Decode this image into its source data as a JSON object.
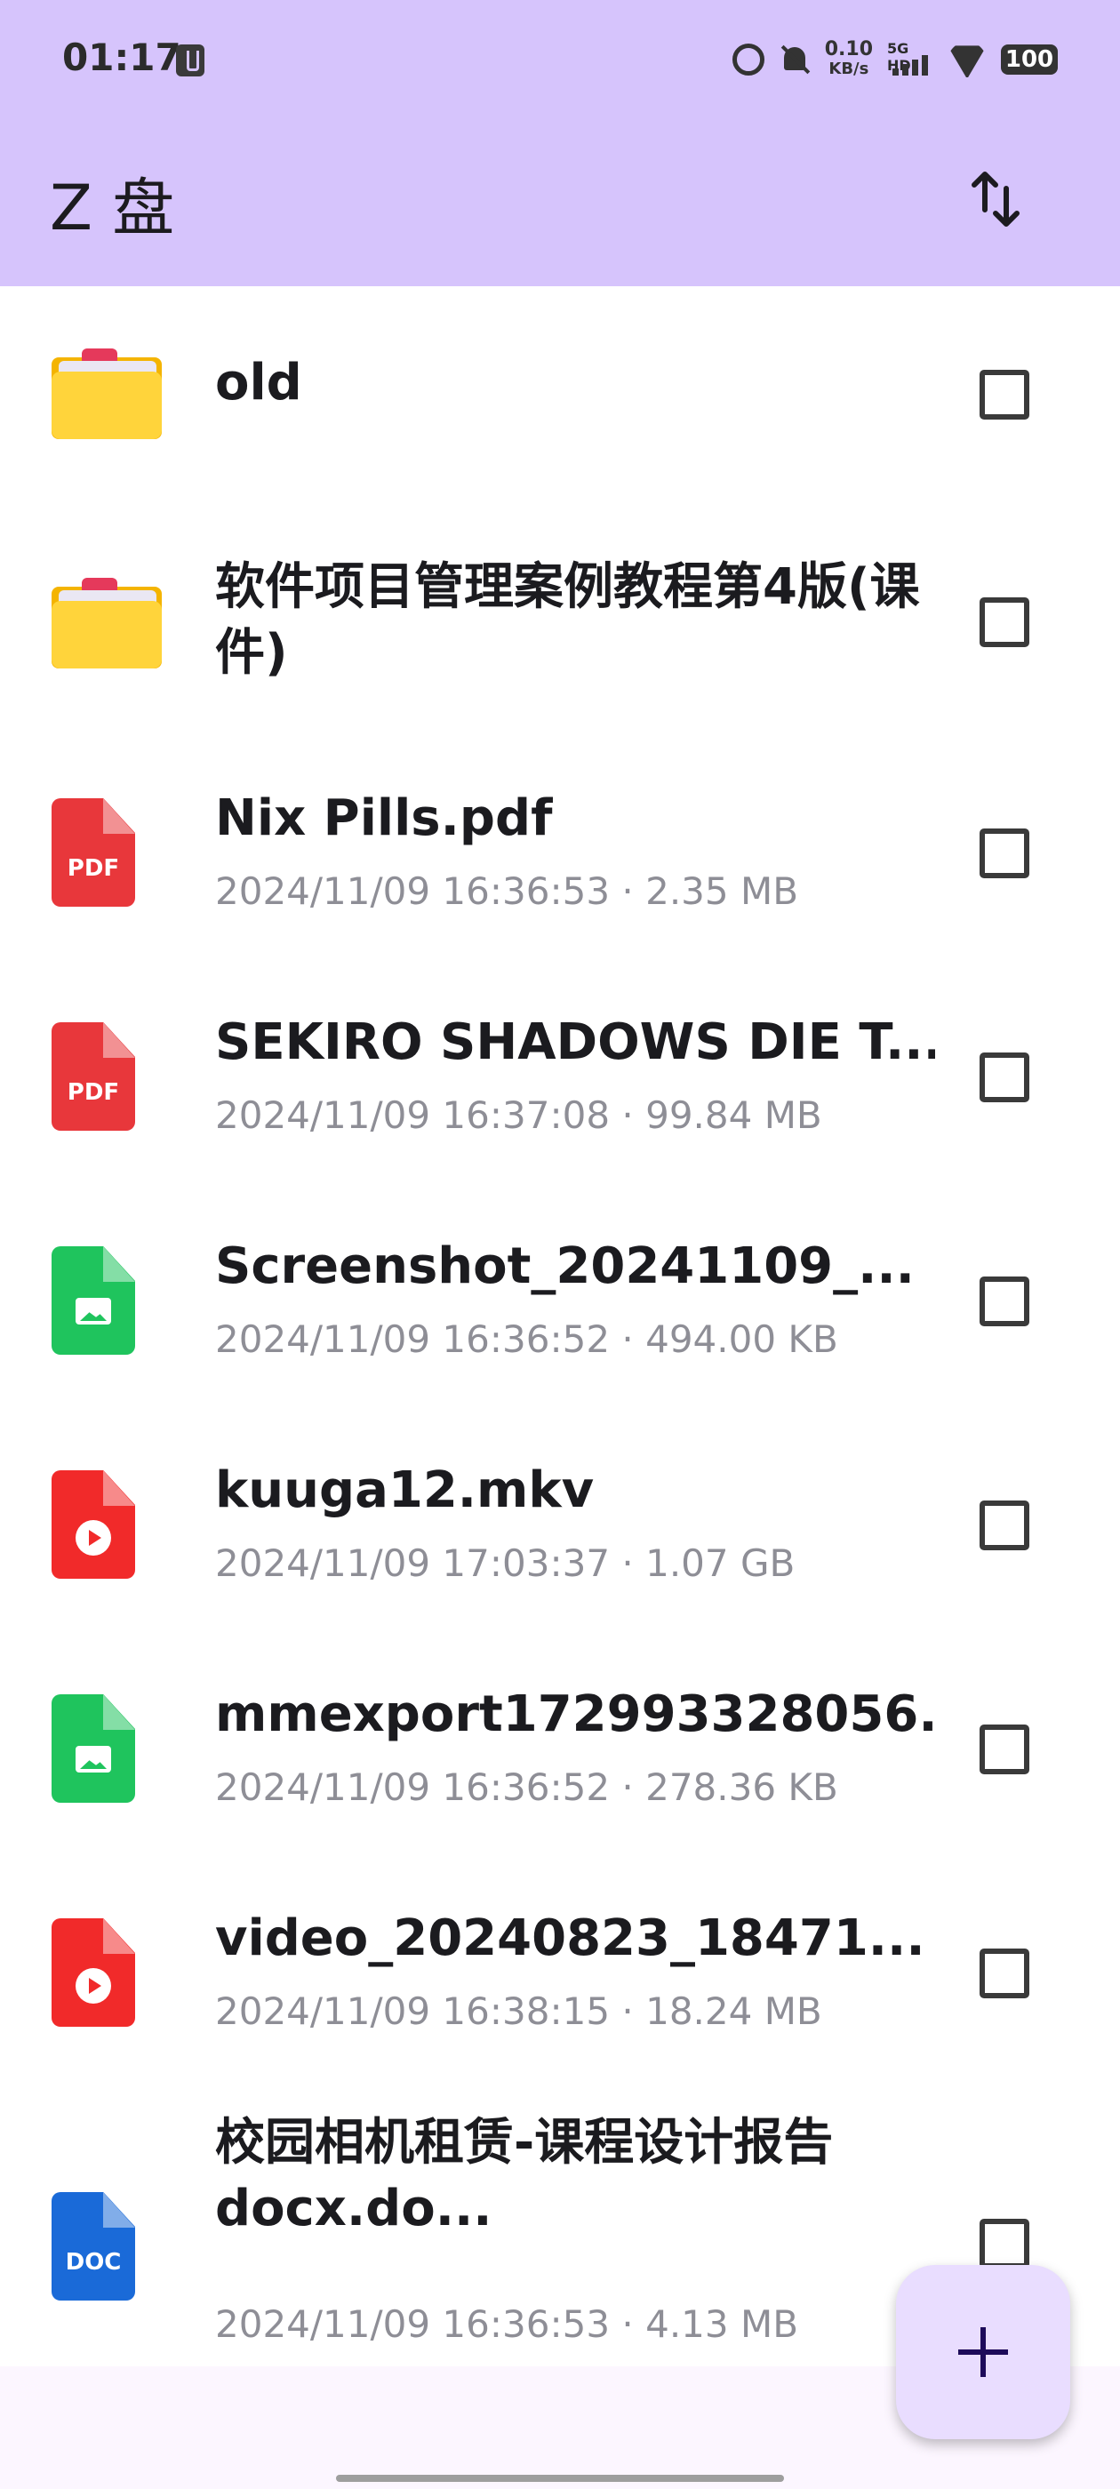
{
  "status_bar": {
    "time": "01:17",
    "net_speed": "0.10",
    "net_unit": "KB/s",
    "network_label": "5G HD",
    "battery": "100",
    "icons": [
      "usb-icon",
      "alarm-icon",
      "bell-off-icon",
      "signal-icon",
      "wifi-icon",
      "battery-icon"
    ]
  },
  "app_bar": {
    "title": "Z 盘",
    "action_icon": "sort-icon"
  },
  "files": [
    {
      "name": "old",
      "type": "folder",
      "meta": ""
    },
    {
      "name": "软件项目管理案例教程第4版(课件)",
      "type": "folder",
      "meta": ""
    },
    {
      "name": "Nix Pills.pdf",
      "type": "pdf",
      "icon_label": "PDF",
      "meta": "2024/11/09 16:36:53 · 2.35 MB"
    },
    {
      "name": "SEKIRO SHADOWS DIE T...",
      "type": "pdf",
      "icon_label": "PDF",
      "meta": "2024/11/09 16:37:08 · 99.84 MB"
    },
    {
      "name": "Screenshot_20241109_...",
      "type": "image",
      "meta": "2024/11/09 16:36:52 · 494.00 KB"
    },
    {
      "name": "kuuga12.mkv",
      "type": "video",
      "meta": "2024/11/09 17:03:37 · 1.07 GB"
    },
    {
      "name": "mmexport172993328056...",
      "type": "image",
      "meta": "2024/11/09 16:36:52 · 278.36 KB"
    },
    {
      "name": "video_20240823_18471...",
      "type": "video",
      "meta": "2024/11/09 16:38:15 · 18.24 MB"
    },
    {
      "name": "校园相机租赁-课程设计报告docx.do...",
      "type": "doc",
      "icon_label": "DOC",
      "meta": "2024/11/09 16:36:53 · 4.13 MB"
    }
  ],
  "fab": {
    "icon": "plus-icon"
  },
  "colors": {
    "app_bar": "#d6c4fc",
    "fab": "#e9ddff",
    "pdf": "#e8373b",
    "image": "#1fc45d",
    "video": "#f12a2a",
    "doc": "#1a6ad8",
    "folder": "#ffd43b"
  }
}
